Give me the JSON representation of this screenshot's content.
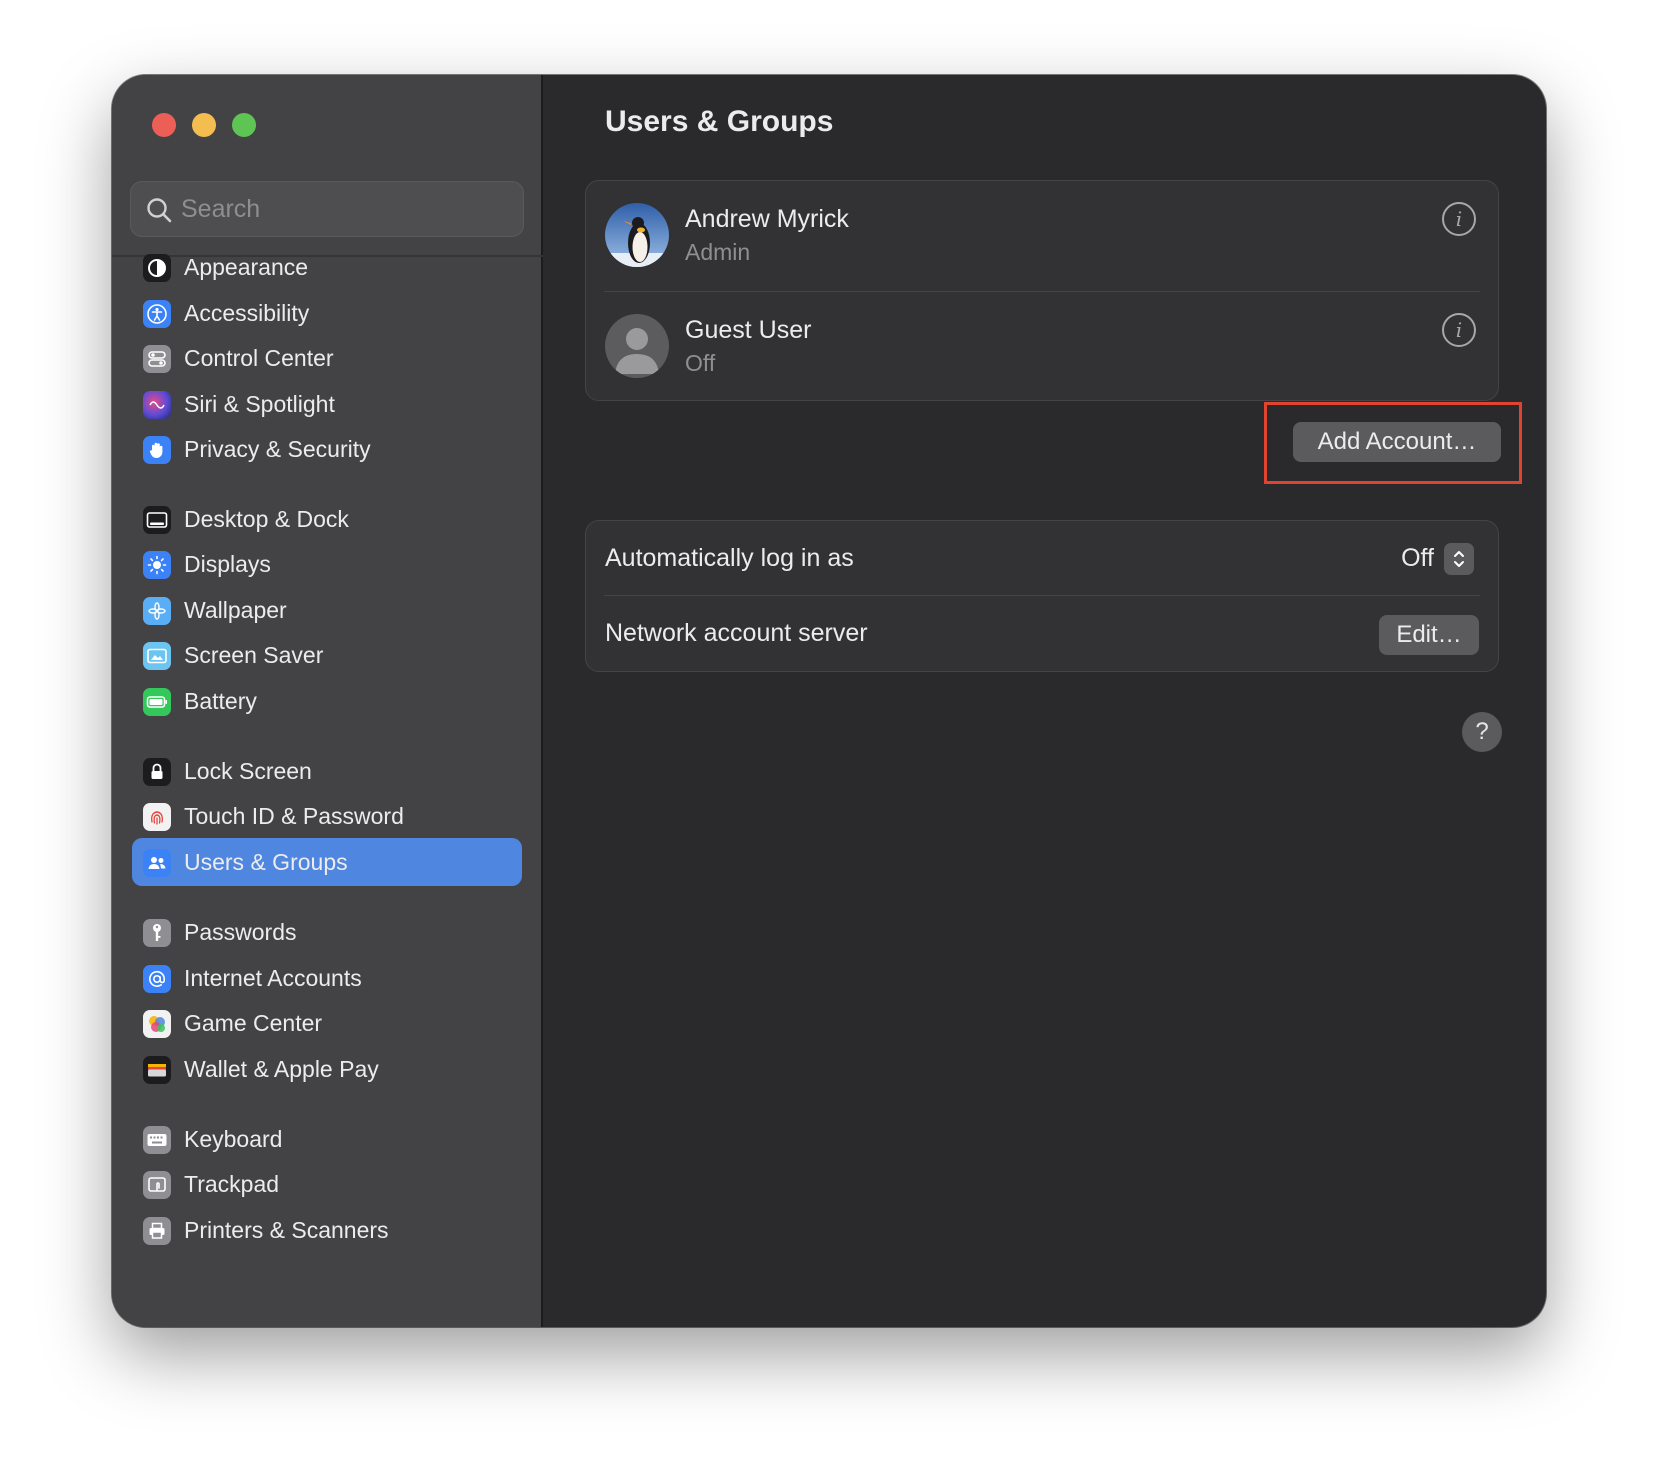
{
  "window": {
    "title": "Users & Groups"
  },
  "search": {
    "placeholder": "Search",
    "icon": "search-icon"
  },
  "sidebar": {
    "items": [
      {
        "label": "Appearance",
        "icon": "appearance-icon",
        "color": "#1c1c1e",
        "selected": false
      },
      {
        "label": "Accessibility",
        "icon": "accessibility-icon",
        "color": "#3b82f6",
        "selected": false
      },
      {
        "label": "Control Center",
        "icon": "control-center-icon",
        "color": "#8e8e93",
        "selected": false
      },
      {
        "label": "Siri & Spotlight",
        "icon": "siri-icon",
        "color": "#5b4bd6",
        "selected": false
      },
      {
        "label": "Privacy & Security",
        "icon": "hand-icon",
        "color": "#3b82f6",
        "selected": false
      },
      {
        "label": "Desktop & Dock",
        "icon": "dock-icon",
        "color": "#1c1c1e",
        "selected": false
      },
      {
        "label": "Displays",
        "icon": "sun-icon",
        "color": "#3b82f6",
        "selected": false
      },
      {
        "label": "Wallpaper",
        "icon": "wallpaper-icon",
        "color": "#5aaef5",
        "selected": false
      },
      {
        "label": "Screen Saver",
        "icon": "screen-saver-icon",
        "color": "#6cc4f0",
        "selected": false
      },
      {
        "label": "Battery",
        "icon": "battery-icon",
        "color": "#34c759",
        "selected": false
      },
      {
        "label": "Lock Screen",
        "icon": "lock-icon",
        "color": "#1c1c1e",
        "selected": false
      },
      {
        "label": "Touch ID & Password",
        "icon": "fingerprint-icon",
        "color": "#f2f2f2",
        "selected": false
      },
      {
        "label": "Users & Groups",
        "icon": "users-icon",
        "color": "#3b82f6",
        "selected": true
      },
      {
        "label": "Passwords",
        "icon": "key-icon",
        "color": "#8e8e93",
        "selected": false
      },
      {
        "label": "Internet Accounts",
        "icon": "at-icon",
        "color": "#3b82f6",
        "selected": false
      },
      {
        "label": "Game Center",
        "icon": "game-center-icon",
        "color": "#f2f2f2",
        "selected": false
      },
      {
        "label": "Wallet & Apple Pay",
        "icon": "wallet-icon",
        "color": "#1c1c1e",
        "selected": false
      },
      {
        "label": "Keyboard",
        "icon": "keyboard-icon",
        "color": "#8e8e93",
        "selected": false
      },
      {
        "label": "Trackpad",
        "icon": "trackpad-icon",
        "color": "#8e8e93",
        "selected": false
      },
      {
        "label": "Printers & Scanners",
        "icon": "printer-icon",
        "color": "#8e8e93",
        "selected": false
      }
    ]
  },
  "users": [
    {
      "name": "Andrew Myrick",
      "role": "Admin",
      "avatar": "penguin-avatar"
    },
    {
      "name": "Guest User",
      "role": "Off",
      "avatar": "guest-avatar"
    }
  ],
  "actions": {
    "add_account": "Add Account…",
    "edit": "Edit…",
    "help": "?"
  },
  "settings": {
    "auto_login_label": "Automatically log in as",
    "auto_login_value": "Off",
    "network_server_label": "Network account server"
  },
  "colors": {
    "accent": "#4f86e0",
    "highlight": "#e0432f"
  }
}
